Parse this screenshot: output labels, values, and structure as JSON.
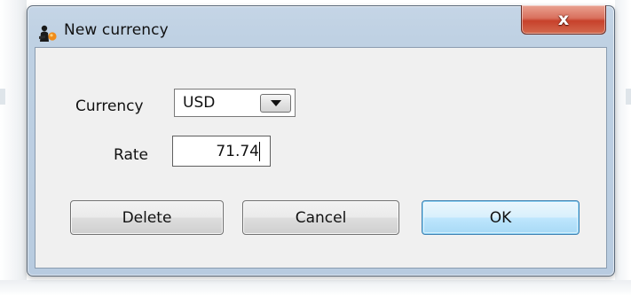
{
  "window": {
    "title": "New currency",
    "app_icon": "app-figure-icon",
    "close_glyph": "x",
    "close_icon": "close-icon"
  },
  "form": {
    "currency_label": "Currency",
    "currency_value": "USD",
    "currency_dropdown_icon": "chevron-down-icon",
    "rate_label": "Rate",
    "rate_value": "71.74"
  },
  "buttons": {
    "delete_label": "Delete",
    "cancel_label": "Cancel",
    "ok_label": "OK"
  },
  "colors": {
    "title_bar": "#bfd1e3",
    "close_button": "#c7412b",
    "default_button": "#bee6fd",
    "client_background": "#f0f0f0"
  }
}
